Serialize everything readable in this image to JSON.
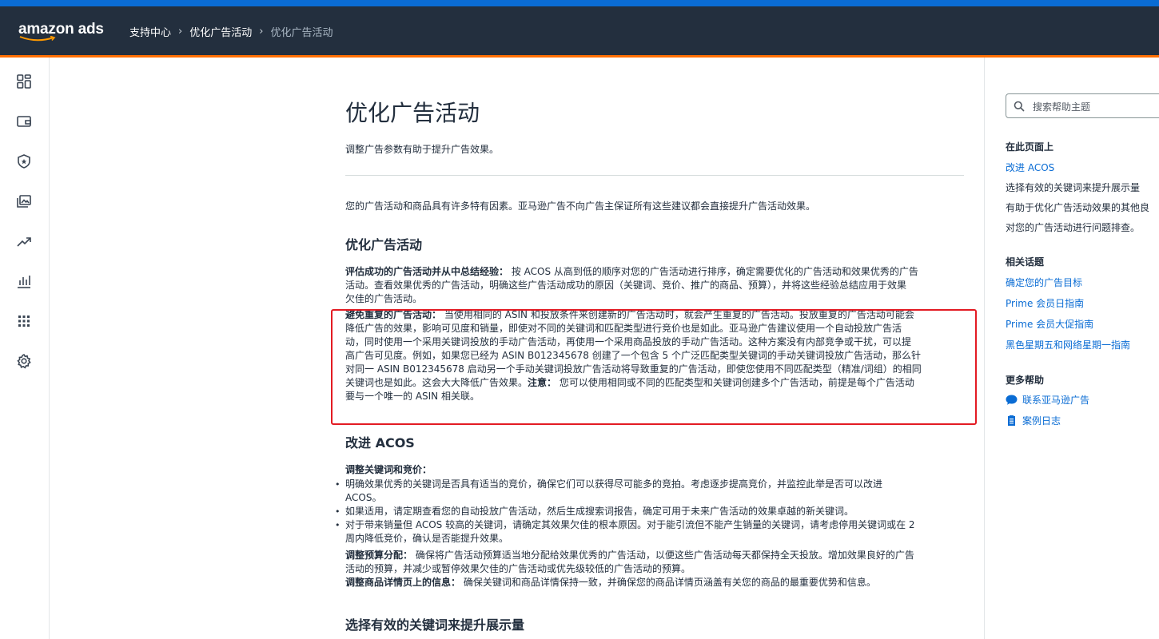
{
  "header": {
    "logo_text": "amazon ads",
    "breadcrumb": [
      "支持中心",
      "优化广告活动",
      "优化广告活动"
    ]
  },
  "sidebar": {
    "icons": [
      "dashboard-icon",
      "wallet-icon",
      "shield-icon",
      "media-icon",
      "trend-icon",
      "bar-chart-icon",
      "apps-grid-icon",
      "settings-icon"
    ]
  },
  "article": {
    "title": "优化广告活动",
    "subtitle": "调整广告参数有助于提升广告效果。",
    "intro": "您的广告活动和商品具有许多特有因素。亚马逊广告不向广告主保证所有这些建议都会直接提升广告活动效果。",
    "section1": {
      "heading": "优化广告活动",
      "para1_label": "评估成功的广告活动并从中总结经验：",
      "para1_lines": [
        "按 ACOS 从高到低的顺序对您的广告活动进行排序，确定需要优化的广告活动和效果优秀的广告",
        "活动。查看效果优秀的广告活动，明确这些广告活动成功的原因（关键词、竞价、推广的商品、预算），并将这些经验总结应用于效果",
        "欠佳的广告活动。"
      ],
      "para2_label": "避免重复的广告活动：",
      "para2_lines": [
        "当使用相同的 ASIN 和投放条件来创建新的广告活动时，就会产生重复的广告活动。投放重复的广告活动可能会",
        "降低广告的效果，影响可见度和销量，即使对不同的关键词和匹配类型进行竞价也是如此。亚马逊广告建议使用一个自动投放广告活",
        "动，同时使用一个采用关键词投放的手动广告活动，再使用一个采用商品投放的手动广告活动。这种方案没有内部竞争或干扰，可以提",
        "高广告可见度。例如，如果您已经为 ASIN B012345678 创建了一个包含 5 个广泛匹配类型关键词的手动关键词投放广告活动，那么针",
        "对同一 ASIN B012345678 启动另一个手动关键词投放广告活动将导致重复的广告活动，即使您使用不同匹配类型（精准/词组）的相同",
        "关键词也是如此。这会大大降低广告效果。"
      ],
      "note_label": "注意：",
      "note_text_line1": "您可以使用相同或不同的匹配类型和关键词创建多个广告活动，前提是每个广告活动",
      "note_text_line2": "要与一个唯一的 ASIN 相关联。"
    },
    "section2": {
      "heading": "改进 ACOS",
      "keyword_label": "调整关键词和竞价：",
      "bullets": [
        [
          "明确效果优秀的关键词是否具有适当的竞价，确保它们可以获得尽可能多的竞拍。考虑逐步提高竞价，并监控此举是否可以改进",
          "ACOS。"
        ],
        [
          "如果适用，请定期查看您的自动投放广告活动，然后生成搜索词报告，确定可用于未来广告活动的效果卓越的新关键词。"
        ],
        [
          "对于带来销量但 ACOS 较高的关键词，请确定其效果欠佳的根本原因。对于能引流但不能产生销量的关键词，请考虑停用关键词或在 2",
          "周内降低竞价，确认是否能提升效果。"
        ]
      ],
      "budget_label": "调整预算分配：",
      "budget_lines": [
        "确保将广告活动预算适当地分配给效果优秀的广告活动，以便这些广告活动每天都保持全天投放。增加效果良好的广告",
        "活动的预算，并减少或暂停效果欠佳的广告活动或优先级较低的广告活动的预算。"
      ],
      "detail_label": "调整商品详情页上的信息：",
      "detail_text": "确保关键词和商品详情保持一致，并确保您的商品详情页涵盖有关您的商品的最重要优势和信息。"
    },
    "section3": {
      "heading": "选择有效的关键词来提升展示量"
    }
  },
  "right_panel": {
    "search_placeholder": "搜索帮助主题",
    "on_this_page": {
      "heading": "在此页面上",
      "items": [
        "改进 ACOS",
        "选择有效的关键词来提升展示量",
        "有助于优化广告活动效果的其他良",
        "对您的广告活动进行问题排查。"
      ]
    },
    "related": {
      "heading": "相关话题",
      "items": [
        "确定您的广告目标",
        "Prime 会员日指南",
        "Prime 会员大促指南",
        "黑色星期五和网络星期一指南"
      ]
    },
    "more_help": {
      "heading": "更多帮助",
      "items": [
        "联系亚马逊广告",
        "案例日志"
      ]
    }
  },
  "colors": {
    "header_bg": "#232f3e",
    "top_stripe": "#0a6cd4",
    "accent_orange": "#ff6f00",
    "link": "#0a6cd4",
    "highlight_border": "#e31b23"
  }
}
